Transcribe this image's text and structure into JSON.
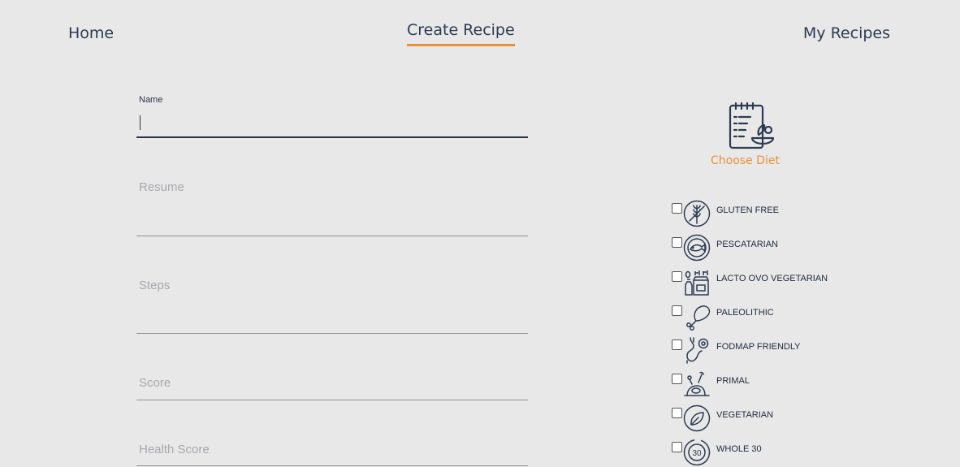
{
  "nav": {
    "home": "Home",
    "create": "Create Recipe",
    "my_recipes": "My Recipes"
  },
  "form": {
    "name_label": "Name",
    "name_value": "",
    "resume_label": "Resume",
    "steps_label": "Steps",
    "score_label": "Score",
    "health_label": "Health Score"
  },
  "diet": {
    "title": "Choose Diet",
    "items": [
      {
        "label": "GLUTEN FREE",
        "icon": "wheat-icon"
      },
      {
        "label": "PESCATARIAN",
        "icon": "fish-icon"
      },
      {
        "label": "LACTO OVO VEGETARIAN",
        "icon": "dairy-icon"
      },
      {
        "label": "PALEOLITHIC",
        "icon": "drumstick-icon"
      },
      {
        "label": "FODMAP FRIENDLY",
        "icon": "stomach-icon"
      },
      {
        "label": "PRIMAL",
        "icon": "meat-icon"
      },
      {
        "label": "VEGETARIAN",
        "icon": "leaf-icon"
      },
      {
        "label": "WHOLE 30",
        "icon": "whole30-icon"
      }
    ]
  },
  "colors": {
    "accent": "#e8913b",
    "navy": "#2d3b52",
    "background": "#e8e8e8"
  }
}
